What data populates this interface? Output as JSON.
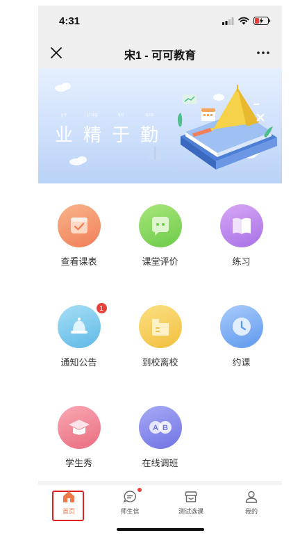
{
  "status": {
    "time": "4:31"
  },
  "nav": {
    "title": "宋1 - 可可教育",
    "close_icon": "close-icon",
    "more_icon": "more-icon"
  },
  "banner": {
    "motto": [
      {
        "char": "业",
        "pinyin": "yè"
      },
      {
        "char": "精",
        "pinyin": "jīng"
      },
      {
        "char": "于",
        "pinyin": "yú"
      },
      {
        "char": "勤",
        "pinyin": "qín"
      }
    ]
  },
  "grid": [
    {
      "label": "查看课表",
      "icon": "calendar-check-icon",
      "color_from": "#f9b48a",
      "color_to": "#f07f5a"
    },
    {
      "label": "课堂评价",
      "icon": "chat-bubble-icon",
      "color_from": "#a9e67c",
      "color_to": "#6ccb49"
    },
    {
      "label": "练习",
      "icon": "book-icon",
      "color_from": "#d7a7f5",
      "color_to": "#a771e6"
    },
    {
      "label": "通知公告",
      "icon": "bell-icon",
      "color_from": "#a6def5",
      "color_to": "#5fb9e7",
      "badge": "1"
    },
    {
      "label": "到校离校",
      "icon": "card-icon",
      "color_from": "#fbe083",
      "color_to": "#f2bf3e"
    },
    {
      "label": "约课",
      "icon": "clock-icon",
      "color_from": "#a9cbfb",
      "color_to": "#5f99ee"
    },
    {
      "label": "学生秀",
      "icon": "graduation-cap-icon",
      "color_from": "#f9a8b4",
      "color_to": "#e96d7f"
    },
    {
      "label": "在线调班",
      "icon": "ab-switch-icon",
      "color_from": "#a7a9f5",
      "color_to": "#7074e3"
    }
  ],
  "tabs": [
    {
      "label": "首页",
      "icon": "home-icon",
      "active": true
    },
    {
      "label": "师生信",
      "icon": "message-icon",
      "dot": true
    },
    {
      "label": "测试选课",
      "icon": "shop-icon"
    },
    {
      "label": "我的",
      "icon": "user-icon"
    }
  ],
  "colors": {
    "accent": "#f07a4a",
    "badge": "#e8403a",
    "highlight": "#e02020"
  }
}
